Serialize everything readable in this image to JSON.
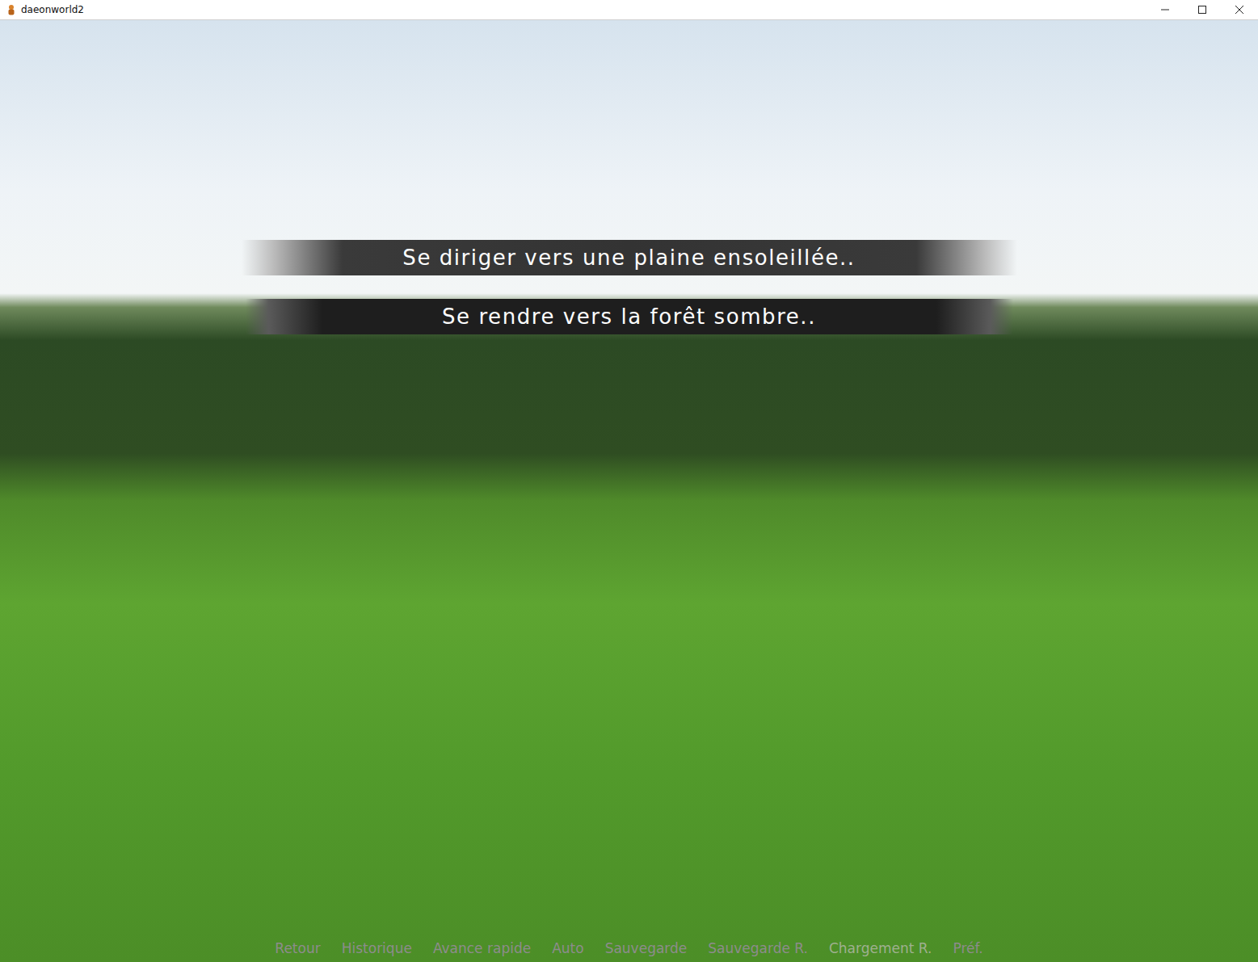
{
  "window": {
    "title": "daeonworld2"
  },
  "choices": [
    {
      "label": "Se diriger vers une plaine ensoleillée..",
      "selected": true
    },
    {
      "label": "Se rendre vers la forêt sombre..",
      "selected": false
    }
  ],
  "quick_menu": [
    {
      "label": "Retour",
      "disabled": false
    },
    {
      "label": "Historique",
      "disabled": false
    },
    {
      "label": "Avance rapide",
      "disabled": false
    },
    {
      "label": "Auto",
      "disabled": false
    },
    {
      "label": "Sauvegarde",
      "disabled": false
    },
    {
      "label": "Sauvegarde R.",
      "disabled": false
    },
    {
      "label": "Chargement R.",
      "disabled": true
    },
    {
      "label": "Préf.",
      "disabled": false
    }
  ]
}
